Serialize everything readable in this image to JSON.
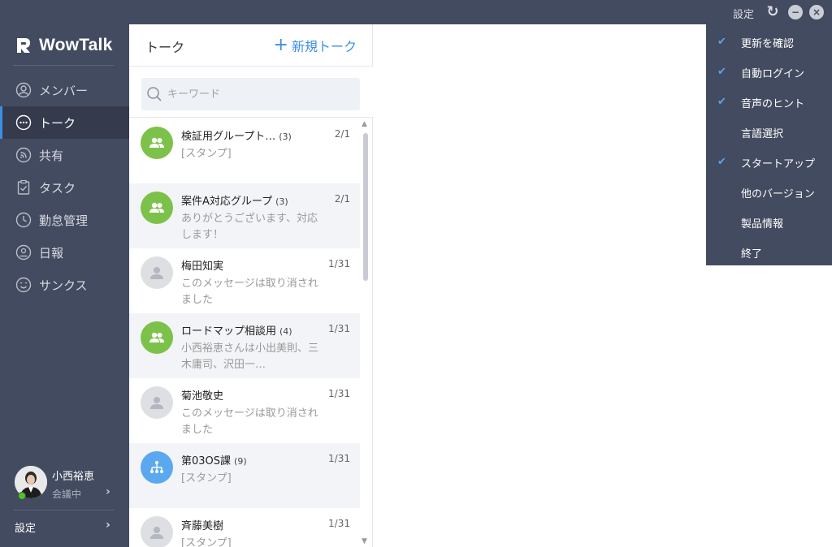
{
  "topbar": {
    "settings_label": "設定"
  },
  "app": {
    "name": "WowTalk"
  },
  "sidebar": {
    "items": [
      {
        "label": "メンバー",
        "icon": "member-icon",
        "active": false
      },
      {
        "label": "トーク",
        "icon": "chat-icon",
        "active": true
      },
      {
        "label": "共有",
        "icon": "share-icon",
        "active": false
      },
      {
        "label": "タスク",
        "icon": "task-icon",
        "active": false
      },
      {
        "label": "勤怠管理",
        "icon": "attendance-icon",
        "active": false
      },
      {
        "label": "日報",
        "icon": "report-icon",
        "active": false
      },
      {
        "label": "サンクス",
        "icon": "thanks-icon",
        "active": false
      }
    ],
    "profile": {
      "name": "小西裕恵",
      "status": "会議中"
    },
    "settings_label": "設定"
  },
  "talk": {
    "title": "トーク",
    "new_label": "新規トーク",
    "search_placeholder": "キーワード",
    "conversations": [
      {
        "name": "検証用グループト…",
        "count": "(3)",
        "date": "2/1",
        "message": "[スタンプ]",
        "avatar": "group"
      },
      {
        "name": "案件A対応グループ",
        "count": "(3)",
        "date": "2/1",
        "message": "ありがとうございます、対応します！",
        "avatar": "group"
      },
      {
        "name": "梅田知実",
        "count": "",
        "date": "1/31",
        "message": "このメッセージは取り消されました",
        "avatar": "person"
      },
      {
        "name": "ロードマップ相談用",
        "count": "(4)",
        "date": "1/31",
        "message": "小西裕恵さんは小出美則、三木庸司、沢田一…",
        "avatar": "group"
      },
      {
        "name": "菊池敬史",
        "count": "",
        "date": "1/31",
        "message": "このメッセージは取り消されました",
        "avatar": "person"
      },
      {
        "name": "第03OS課",
        "count": "(9)",
        "date": "1/31",
        "message": "[スタンプ]",
        "avatar": "org"
      },
      {
        "name": "斉藤美樹",
        "count": "",
        "date": "1/31",
        "message": "[スタンプ]",
        "avatar": "person"
      }
    ]
  },
  "settings_menu": {
    "items": [
      {
        "label": "更新を確認",
        "checked": true
      },
      {
        "label": "自動ログイン",
        "checked": true
      },
      {
        "label": "音声のヒント",
        "checked": true
      },
      {
        "label": "言語選択",
        "checked": false
      },
      {
        "label": "スタートアップ",
        "checked": true
      },
      {
        "label": "他のバージョン",
        "checked": false
      },
      {
        "label": "製品情報",
        "checked": false
      },
      {
        "label": "終了",
        "checked": false
      }
    ]
  },
  "colors": {
    "sidebar_bg": "#434b60",
    "accent": "#3d8ee5",
    "group_green": "#7cc24a",
    "org_blue": "#5aa9ef",
    "check_blue": "#5ba3ef"
  }
}
